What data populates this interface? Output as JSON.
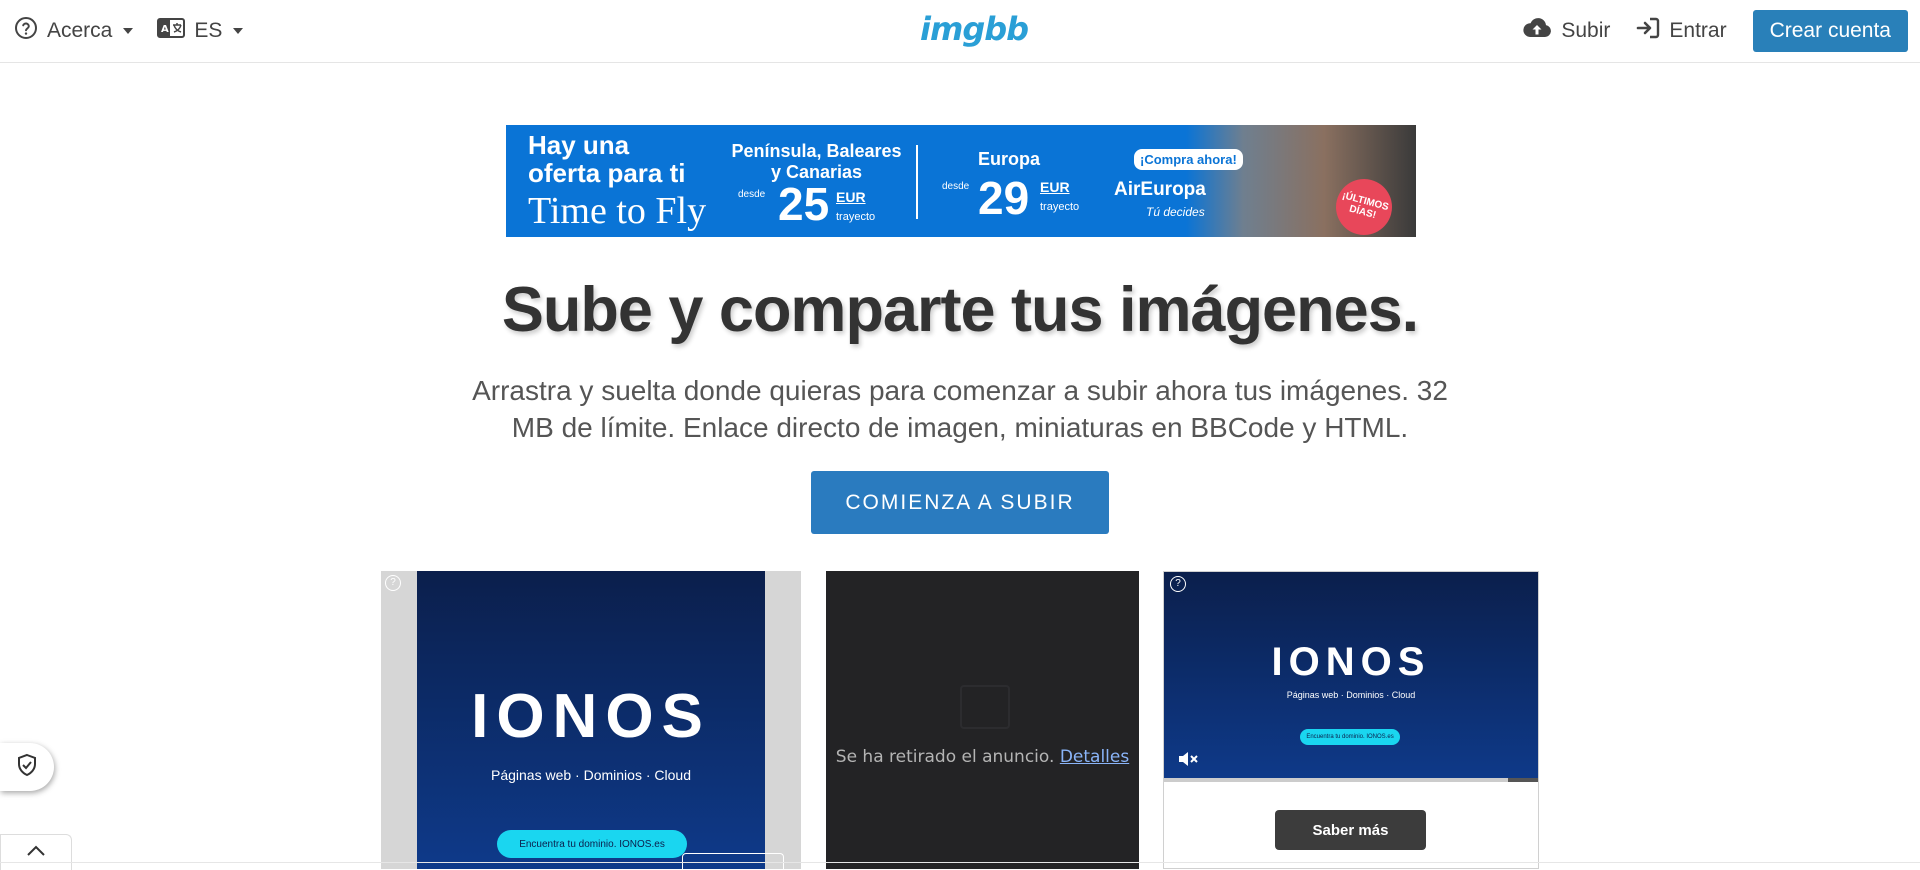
{
  "header": {
    "about_label": "Acerca",
    "language_label": "ES",
    "logo_text": "imgbb",
    "upload_label": "Subir",
    "login_label": "Entrar",
    "create_account_label": "Crear cuenta"
  },
  "banner_ad": {
    "headline": "Hay una oferta para ti",
    "tagline": "Time to Fly",
    "region1": "Península, Baleares y Canarias",
    "from1": "desde",
    "price1": "25",
    "currency1": "EUR",
    "unit1": "trayecto",
    "region2": "Europa",
    "from2": "desde",
    "price2": "29",
    "currency2": "EUR",
    "unit2": "trayecto",
    "cta_badge": "¡Compra ahora!",
    "brand": "AirEuropa",
    "brand_slogan": "Tú decides",
    "sticker": "¡ÚLTIMOS DÍAS!"
  },
  "hero": {
    "title": "Sube y comparte tus imágenes.",
    "description": "Arrastra y suelta donde quieras para comenzar a subir ahora tus imágenes. 32 MB de límite. Enlace directo de imagen, miniaturas en BBCode y HTML.",
    "cta_label": "COMIENZA A SUBIR"
  },
  "ads": {
    "left": {
      "brand": "IONOS",
      "subtitle": "Páginas web · Dominios · Cloud",
      "pill": "Encuentra tu dominio.  IONOS.es"
    },
    "middle": {
      "removed_text": "Se ha retirado el anuncio.",
      "details_link": "Detalles"
    },
    "right": {
      "brand": "IONOS",
      "subtitle": "Páginas web · Dominios · Cloud",
      "pill": "Encuentra tu dominio.  IONOS.es",
      "learn_more_label": "Saber más",
      "video_progress": 0.92
    }
  },
  "colors": {
    "brand_blue": "#2a9fd6",
    "primary_button": "#2980b9",
    "banner_blue": "#0a74d6",
    "ionos_navy": "#0b1f4c",
    "ionos_cyan": "#1ad6f0"
  },
  "icons": {
    "about": "question-circle-icon",
    "language": "language-icon",
    "upload": "cloud-upload-icon",
    "login": "sign-in-icon",
    "shield": "shield-check-icon",
    "collapse": "chevron-up-icon",
    "mute": "volume-mute-icon"
  }
}
